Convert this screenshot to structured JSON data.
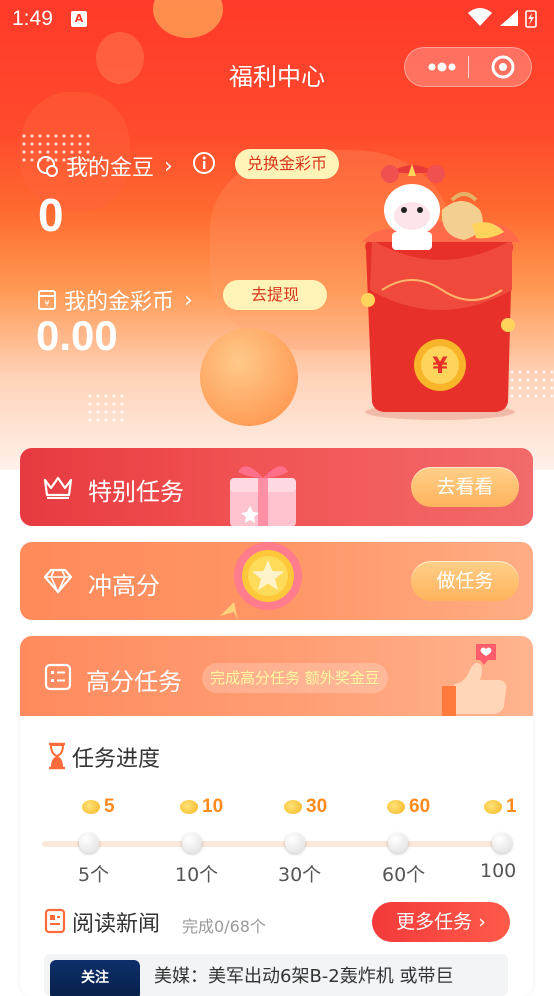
{
  "status_bar": {
    "time": "1:49",
    "notification_badge": "A"
  },
  "nav": {
    "title": "福利中心"
  },
  "beans": {
    "label": "我的金豆",
    "value": "0",
    "exchange_button": "兑换金彩币"
  },
  "coins": {
    "label": "我的金彩币",
    "value": "0.00",
    "withdraw_button": "去提现"
  },
  "mascot": {
    "coin_symbol": "¥"
  },
  "special_task": {
    "title": "特别任务",
    "button": "去看看"
  },
  "score_task": {
    "title": "冲高分",
    "button": "做任务"
  },
  "high_score": {
    "title": "高分任务",
    "tag": "完成高分任务 额外奖金豆",
    "progress_title": "任务进度",
    "milestones": [
      {
        "reward": "5",
        "label": "5个"
      },
      {
        "reward": "10",
        "label": "10个"
      },
      {
        "reward": "30",
        "label": "30个"
      },
      {
        "reward": "60",
        "label": "60个"
      },
      {
        "reward": "1",
        "label": "100"
      }
    ],
    "news": {
      "title": "阅读新闻",
      "count": "完成0/68个",
      "more_button": "更多任务 ›",
      "thumb_text": "关注",
      "headline": "美媒：美军出动6架B-2轰炸机 或带巨"
    }
  },
  "colors": {
    "primary_red": "#ff3a2a",
    "accent_orange": "#ff9566",
    "coin_gold": "#f6b51f",
    "pill_yellow": "#fff3b8"
  }
}
